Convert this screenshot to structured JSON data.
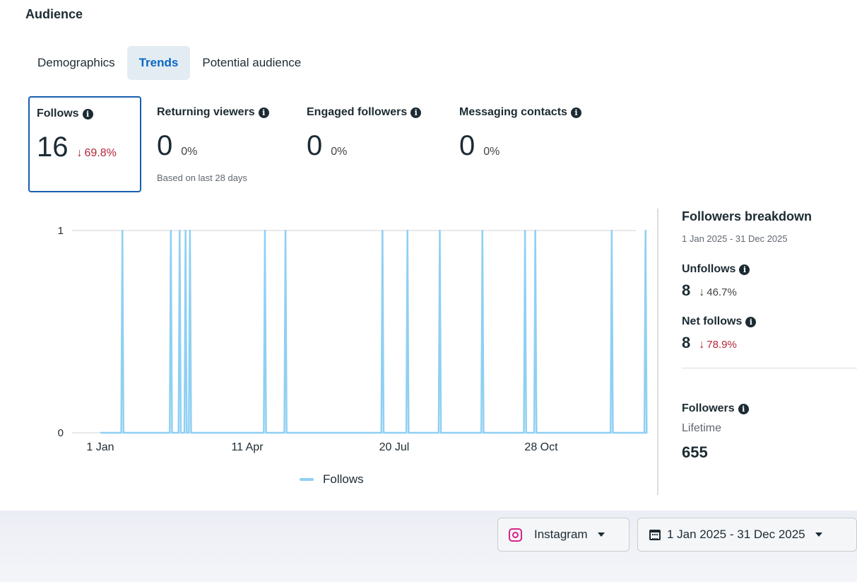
{
  "header": {
    "title": "Audience"
  },
  "tabs": [
    {
      "label": "Demographics",
      "active": false
    },
    {
      "label": "Trends",
      "active": true
    },
    {
      "label": "Potential audience",
      "active": false
    }
  ],
  "metrics": [
    {
      "label": "Follows",
      "value": "16",
      "change": "69.8%",
      "direction": "down"
    },
    {
      "label": "Returning viewers",
      "value": "0",
      "change": "0%",
      "note": "Based on last 28 days"
    },
    {
      "label": "Engaged followers",
      "value": "0",
      "change": "0%"
    },
    {
      "label": "Messaging contacts",
      "value": "0",
      "change": "0%"
    }
  ],
  "icons": {
    "info": "info-icon",
    "down_arrow": "↓"
  },
  "chart_data": {
    "type": "line",
    "ylim": [
      0,
      1
    ],
    "y_ticks": [
      "0",
      "1"
    ],
    "x_ticks": [
      {
        "label": "1 Jan",
        "day": 1
      },
      {
        "label": "11 Apr",
        "day": 101
      },
      {
        "label": "20 Jul",
        "day": 201
      },
      {
        "label": "28 Oct",
        "day": 301
      }
    ],
    "x_range_days": [
      1,
      365
    ],
    "series": [
      {
        "name": "Follows",
        "color": "#8fd0f3",
        "spike_days": [
          16,
          49,
          55,
          59,
          62,
          113,
          127,
          193,
          210,
          232,
          261,
          290,
          297,
          349,
          372
        ]
      }
    ],
    "legend": {
      "placement": "bottom-center"
    }
  },
  "breakdown": {
    "title": "Followers breakdown",
    "range": "1 Jan 2025 - 31 Dec 2025",
    "unfollows": {
      "label": "Unfollows",
      "value": "8",
      "change": "46.7%",
      "direction": "down"
    },
    "net_follows": {
      "label": "Net follows",
      "value": "8",
      "change": "78.9%",
      "direction": "down"
    },
    "followers": {
      "label": "Followers",
      "sub": "Lifetime",
      "value": "655"
    }
  },
  "filters": {
    "platform": {
      "label": "Instagram",
      "icon": "instagram-icon"
    },
    "date_range": {
      "label": "1 Jan 2025 - 31 Dec 2025",
      "icon": "calendar-icon"
    }
  },
  "colors": {
    "accent": "#0a66c2",
    "negative": "#b3263a",
    "selected_border": "#1a5eb0",
    "series": "#8fd0f3"
  }
}
